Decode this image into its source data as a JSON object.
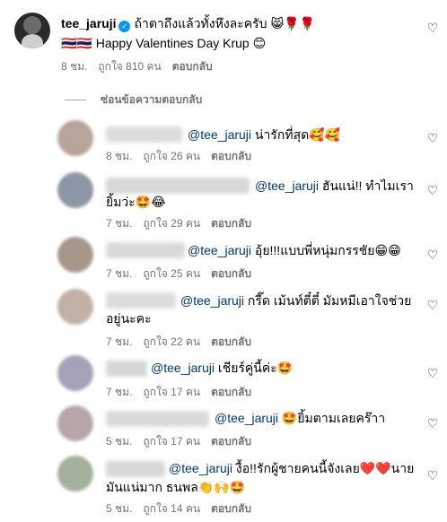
{
  "main": {
    "username": "tee_jaruji",
    "caption_line1": "ถ้าตาถึงแล้วทั้งหึงละครับ 😸🌹🌹",
    "caption_line2": "🇹🇭🇹🇭 Happy Valentines Day Krup 😊",
    "time": "8 ชม.",
    "likes": "ถูกใจ 810 คน",
    "reply": "ตอบกลับ"
  },
  "hide_replies": "ซ่อนข้อความตอบกลับ",
  "replies": [
    {
      "mention": "@tee_jaruji",
      "text": " น่ารักที่สุด🥰🥰",
      "text2": "",
      "time": "8 ชม.",
      "likes": "ถูกใจ 26 คน",
      "reply": "ตอบกลับ"
    },
    {
      "mention": "@tee_jaruji",
      "text": " ฮันแน่!! ทำไมเรา",
      "text2": "ยิ้มว่ะ🤩😂",
      "time": "7 ชม.",
      "likes": "ถูกใจ 29 คน",
      "reply": "ตอบกลับ"
    },
    {
      "mention": "@tee_jaruji",
      "text": " อุ้ย!!!แบบพี่หนุ่มกรรชัย😁😁",
      "text2": "",
      "time": "7 ชม.",
      "likes": "ถูกใจ 25 คน",
      "reply": "ตอบกลับ"
    },
    {
      "mention": "@tee_jaruji",
      "text": " กรี๊ด เม้นท์ตี๋ตี๋ มัมหมีเอาใจช่วย",
      "text2": "อยู่นะคะ",
      "time": "7 ชม.",
      "likes": "ถูกใจ 22 คน",
      "reply": "ตอบกลับ"
    },
    {
      "mention": "@tee_jaruji",
      "text": " เชียร์คู่นี้ค่ะ🤩",
      "text2": "",
      "time": "7 ชม.",
      "likes": "ถูกใจ 17 คน",
      "reply": "ตอบกลับ"
    },
    {
      "mention": "@tee_jaruji",
      "text": " 🤩ยิ้มตามเลยคร๊าา",
      "text2": "",
      "time": "5 ชม.",
      "likes": "ถูกใจ 17 คน",
      "reply": "ตอบกลับ"
    },
    {
      "mention": "@tee_jaruji",
      "text": " งื้อ!!รักผู้ชายคนนี้จังเลย❤️❤️นาย",
      "text2": "มันแน่มาก ธนพล👏🙌🤩",
      "time": "5 ชม.",
      "likes": "ถูกใจ 14 คน",
      "reply": "ตอบกลับ"
    }
  ]
}
